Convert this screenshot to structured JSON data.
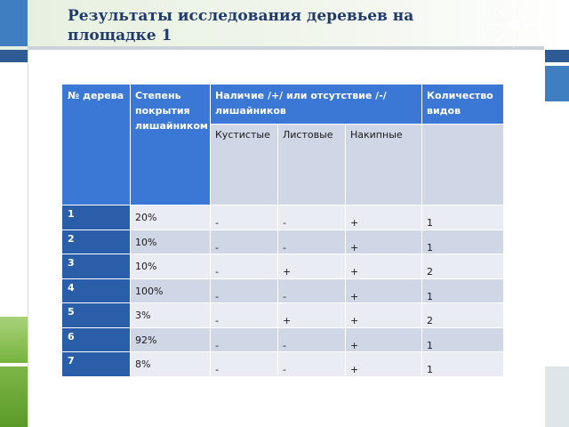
{
  "title": "Результаты исследования деревьев на площадке 1",
  "table": {
    "headers": {
      "col1": "№ дерева",
      "col2": "Степень покрытия лишайником",
      "col3": "Наличие /+/ или отсутствие /-/ лишайников",
      "col3_sub1": "Кустистые",
      "col3_sub2": "Листовые",
      "col3_sub3": "Накипные",
      "col4": "Количество видов"
    },
    "rows": [
      {
        "n": "1",
        "cover": "20%",
        "k": "-",
        "l": "-",
        "nak": "+",
        "count": "1"
      },
      {
        "n": "2",
        "cover": "10%",
        "k": "-",
        "l": "-",
        "nak": "+",
        "count": "1"
      },
      {
        "n": "3",
        "cover": "10%",
        "k": "-",
        "l": "+",
        "nak": "+",
        "count": "2"
      },
      {
        "n": "4",
        "cover": "100%",
        "k": "-",
        "l": "-",
        "nak": "+",
        "count": "1"
      },
      {
        "n": "5",
        "cover": "3%",
        "k": "-",
        "l": "+",
        "nak": "+",
        "count": "2"
      },
      {
        "n": "6",
        "cover": "92%",
        "k": "-",
        "l": "-",
        "nak": "+",
        "count": "1"
      },
      {
        "n": "7",
        "cover": "8%",
        "k": "-",
        "l": "-",
        "nak": "+",
        "count": "1"
      }
    ]
  },
  "colors": {
    "header_blue": "#3b78d6",
    "header_dark": "#2a5ea9",
    "row_light": "#cfd6e6",
    "row_pale": "#e9ecf3",
    "title": "#1f3a6b"
  }
}
